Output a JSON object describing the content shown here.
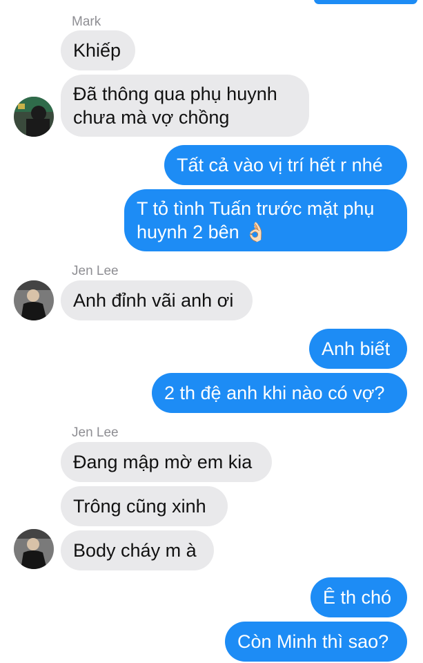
{
  "conversation": {
    "groups": [
      {
        "sender": "Mark",
        "messages": [
          "Khiếp",
          "Đã thông qua phụ huynh chưa mà vợ chồng"
        ]
      },
      {
        "outgoing": [
          "Tất cả vào vị trí hết r nhé",
          "T tỏ tình Tuấn trước mặt phụ huynh 2 bên 👌🏻"
        ]
      },
      {
        "sender": "Jen Lee",
        "messages": [
          "Anh đỉnh vãi anh ơi"
        ]
      },
      {
        "outgoing": [
          "Anh biết",
          "2 th đệ anh khi nào có vợ?"
        ]
      },
      {
        "sender": "Jen Lee",
        "messages": [
          "Đang mập mờ em kia",
          "Trông cũng xinh",
          "Body cháy m à"
        ]
      },
      {
        "outgoing": [
          "Ê th chó",
          "Còn Minh thì sao?"
        ]
      }
    ]
  },
  "bubble_text": {
    "m1": "Khiếp",
    "m2_line1": "Đã thông qua phụ huynh",
    "m2_line2": "chưa mà vợ chồng",
    "o1": "Tất cả vào vị trí hết r nhé",
    "o2_line1": "T tỏ tình Tuấn trước mặt phụ",
    "o2_line2": "huynh 2 bên 👌🏻",
    "j1": "Anh đỉnh vãi anh ơi",
    "o3": "Anh biết",
    "o4": "2 th đệ anh khi nào có vợ?",
    "j2": "Đang mập mờ em kia",
    "j3": "Trông cũng xinh",
    "j4": "Body cháy m à",
    "o5": "Ê th chó",
    "o6": "Còn Minh thì sao?"
  },
  "senders": {
    "mark": "Mark",
    "jen1": "Jen Lee",
    "jen2": "Jen Lee"
  },
  "colors": {
    "incoming_bubble": "#e9e9eb",
    "outgoing_bubble": "#1d8cf5",
    "sender_label": "#8e8e93"
  },
  "icons": {
    "avatar_mark": "avatar-photo",
    "avatar_jen": "avatar-photo"
  }
}
